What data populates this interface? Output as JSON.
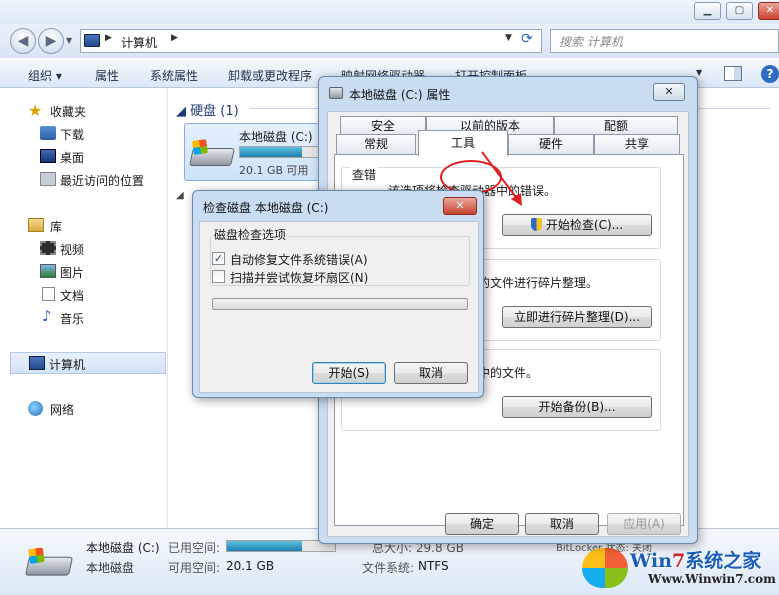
{
  "explorer": {
    "address": {
      "location": "计算机"
    },
    "search_placeholder": "搜索 计算机",
    "toolbar": {
      "organize": "组织",
      "properties": "属性",
      "system_properties": "系统属性",
      "uninstall": "卸载或更改程序",
      "map_drive": "映射网络驱动器",
      "control_panel": "打开控制面板"
    },
    "nav": {
      "favorites": "收藏夹",
      "downloads": "下载",
      "desktop": "桌面",
      "recent": "最近访问的位置",
      "libraries": "库",
      "videos": "视频",
      "pictures": "图片",
      "documents": "文档",
      "music": "音乐",
      "computer": "计算机",
      "network": "网络"
    },
    "content": {
      "group_title": "硬盘 (1)",
      "drive_name": "本地磁盘 (C:)",
      "drive_free": "20.1 GB 可用",
      "drive_used_fraction": 0.69
    },
    "details": {
      "name": "本地磁盘 (C:)",
      "type": "本地磁盘",
      "used_label": "已用空间:",
      "free_label": "可用空间:",
      "free_value": "20.1 GB",
      "total": "总大小: 29.8 GB",
      "fs_label": "文件系统:",
      "fs_value": "NTFS",
      "bitlocker": "BitLocker 状态: 关闭"
    }
  },
  "properties_dialog": {
    "title": "本地磁盘 (C:) 属性",
    "tabs_row1": [
      "安全",
      "以前的版本",
      "配额"
    ],
    "tabs_row2": [
      "常规",
      "工具",
      "硬件",
      "共享"
    ],
    "active_tab": "工具",
    "error_check": {
      "label": "查错",
      "desc": "该选项将检查驱动器中的错误。",
      "button": "开始检查(C)..."
    },
    "defrag": {
      "desc": "器中的文件进行碎片整理。",
      "button": "立即进行碎片整理(D)..."
    },
    "backup": {
      "desc": "动器中的文件。",
      "button": "开始备份(B)..."
    },
    "ok": "确定",
    "cancel": "取消",
    "apply": "应用(A)"
  },
  "check_disk_dialog": {
    "title": "检查磁盘 本地磁盘 (C:)",
    "group_label": "磁盘检查选项",
    "option_fix": "自动修复文件系统错误(A)",
    "option_fix_checked": true,
    "option_scan": "扫描并尝试恢复坏扇区(N)",
    "option_scan_checked": false,
    "progress_fraction": 0,
    "start": "开始(S)",
    "cancel": "取消"
  },
  "watermark": {
    "title_a": "Win",
    "title_b": "7",
    "title_c": "系统之家",
    "url": "Www.Winwin7.com"
  },
  "colors": {
    "accent_blue": "#1e3b78",
    "capacity_bar": "#1d7fb0",
    "annotation_red": "#e02020"
  }
}
